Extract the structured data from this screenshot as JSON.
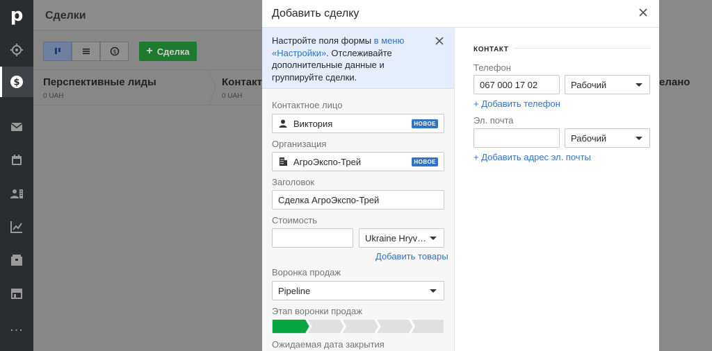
{
  "app": {
    "logo": "p",
    "page_title": "Сделки",
    "add_deal_label": "Сделка",
    "accent_color": "#3173c6",
    "success_color": "#08a742"
  },
  "nav": {
    "items": [
      {
        "icon": "target-icon"
      },
      {
        "icon": "dollar-icon",
        "active": true
      },
      {
        "icon": "mail-icon"
      },
      {
        "icon": "calendar-icon"
      },
      {
        "icon": "contacts-icon"
      },
      {
        "icon": "chart-icon"
      },
      {
        "icon": "box-icon"
      },
      {
        "icon": "store-icon"
      },
      {
        "icon": "more-icon",
        "label": "..."
      }
    ]
  },
  "stages": [
    {
      "name": "Перспективные лиды",
      "sum": "0 UAH"
    },
    {
      "name": "Контакт",
      "sum": "0 UAH"
    },
    {
      "name": "елано",
      "sum": ""
    }
  ],
  "modal": {
    "title": "Добавить сделку",
    "info": {
      "text_before": "Настройте поля формы ",
      "link": "в меню «Настройки»",
      "text_after": ". Отслеживайте дополнительные данные и группируйте сделки."
    },
    "fields": {
      "contact_label": "Контактное лицо",
      "contact_value": "Виктория",
      "contact_badge": "НОВОЕ",
      "org_label": "Организация",
      "org_value": "АгроЭкспо-Трей",
      "org_badge": "НОВОЕ",
      "title_label": "Заголовок",
      "title_value": "Сделка АгроЭкспо-Трей",
      "value_label": "Стоимость",
      "value_value": "",
      "currency": "Ukraine Hryv…",
      "add_products": "Добавить товары",
      "pipeline_label": "Воронка продаж",
      "pipeline_value": "Pipeline",
      "stage_label": "Этап воронки продаж",
      "stage_count": 5,
      "stage_selected": 1,
      "close_date_label": "Ожидаемая дата закрытия"
    },
    "contact_section": {
      "title": "КОНТАКТ",
      "phone_label": "Телефон",
      "phone_value": "067 000 17 02",
      "phone_type": "Рабочий",
      "add_phone": "+ Добавить телефон",
      "email_label": "Эл. почта",
      "email_value": "",
      "email_type": "Рабочий",
      "add_email": "+ Добавить адрес эл. почты"
    }
  }
}
